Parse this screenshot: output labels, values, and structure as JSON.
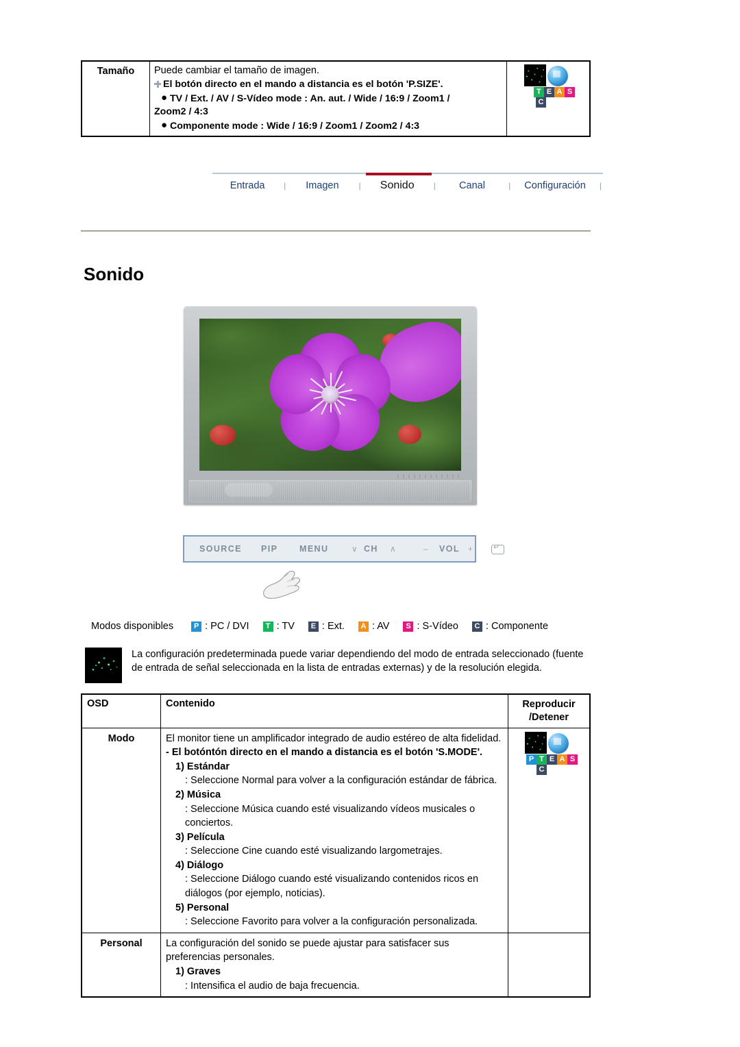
{
  "top_table": {
    "label": "Tamaño",
    "lines": [
      {
        "style": "plain",
        "text": "Puede cambiar el tamaño de imagen."
      },
      {
        "style": "bold-plus",
        "text": "El botón directo en el mando a distancia es el botón 'P.SIZE'."
      },
      {
        "style": "bold-bullet",
        "text": "TV / Ext. / AV / S-Vídeo mode : An. aut. / Wide / 16:9 / Zoom1 /"
      },
      {
        "style": "bold-cont",
        "text": "Zoom2 / 4:3"
      },
      {
        "style": "bold-bullet",
        "text": "Componente mode : Wide / 16:9 / Zoom1 / Zoom2 / 4:3"
      }
    ],
    "icon_badges": [
      "T",
      "E",
      "A",
      "S"
    ],
    "icon_badge_below": "C"
  },
  "nav": {
    "items": [
      {
        "label": "Entrada",
        "active": false
      },
      {
        "label": "Imagen",
        "active": false
      },
      {
        "label": "Sonido",
        "active": true
      },
      {
        "label": "Canal",
        "active": false
      },
      {
        "label": "Configuración",
        "active": false
      }
    ],
    "separator": "|",
    "active_color": "#a51025",
    "link_color": "#1c3f73"
  },
  "page_title": "Sonido",
  "monitor": {
    "buttons": [
      {
        "name": "source",
        "label": "SOURCE"
      },
      {
        "name": "pip",
        "label": "PIP"
      },
      {
        "name": "menu",
        "label": "MENU"
      },
      {
        "name": "ch-down",
        "label": "∨"
      },
      {
        "name": "ch",
        "label": "CH"
      },
      {
        "name": "ch-up",
        "label": "∧"
      },
      {
        "name": "vol-minus",
        "label": "–"
      },
      {
        "name": "vol",
        "label": "VOL"
      },
      {
        "name": "vol-plus",
        "label": "+"
      }
    ],
    "enter_icon": "enter-icon"
  },
  "modos": {
    "label": "Modos disponibles",
    "items": [
      {
        "letter": "P",
        "color": "#1f93d6",
        "text": ": PC / DVI"
      },
      {
        "letter": "T",
        "color": "#17b45c",
        "text": ": TV"
      },
      {
        "letter": "E",
        "color": "#3c4a63",
        "text": ": Ext."
      },
      {
        "letter": "A",
        "color": "#f39019",
        "text": ": AV"
      },
      {
        "letter": "S",
        "color": "#e0197e",
        "text": ": S-Vídeo"
      },
      {
        "letter": "C",
        "color": "#3c4a63",
        "text": ": Componente"
      }
    ]
  },
  "note": {
    "icon": "equalizer-icon",
    "text": "La configuración predeterminada puede variar dependiendo del modo de entrada seleccionado (fuente de entrada de señal seleccionada en la lista de entradas externas) y de la resolución elegida."
  },
  "main_table": {
    "headers": {
      "osd": "OSD",
      "content": "Contenido",
      "play_line1": "Reproducir",
      "play_line2": "/Detener"
    },
    "rows": [
      {
        "osd": "Modo",
        "lines": [
          {
            "style": "plain",
            "text": "El monitor tiene un amplificador integrado de audio estéreo de alta fidelidad."
          },
          {
            "style": "bold",
            "text": "- El botóntón directo en el mando a distancia es el botón 'S.MODE'."
          },
          {
            "style": "num",
            "text": "1) Estándar"
          },
          {
            "style": "desc",
            "text": ": Seleccione Normal para volver a la configuración estándar de fábrica."
          },
          {
            "style": "num",
            "text": "2) Música"
          },
          {
            "style": "desc",
            "text": ": Seleccione Música cuando esté visualizando vídeos musicales o conciertos."
          },
          {
            "style": "num",
            "text": "3) Película"
          },
          {
            "style": "desc",
            "text": ": Seleccione Cine cuando esté visualizando largometrajes."
          },
          {
            "style": "num",
            "text": "4) Diálogo"
          },
          {
            "style": "desc",
            "text": ": Seleccione Diálogo cuando esté visualizando contenidos ricos en diálogos (por ejemplo, noticias)."
          },
          {
            "style": "num",
            "text": "5) Personal"
          },
          {
            "style": "desc",
            "text": ": Seleccione Favorito para volver a la configuración personalizada."
          }
        ],
        "has_icon": true,
        "icon_badges": [
          "P",
          "T",
          "E",
          "A",
          "S"
        ],
        "icon_badge_below": "C"
      },
      {
        "osd": "Personal",
        "lines": [
          {
            "style": "plain",
            "text": "La configuración del sonido se puede ajustar para satisfacer sus preferencias personales."
          },
          {
            "style": "num",
            "text": "1) Graves"
          },
          {
            "style": "desc",
            "text": ": Intensifica el audio de baja frecuencia."
          }
        ],
        "has_icon": false,
        "icon_badges": [],
        "icon_badge_below": ""
      }
    ]
  }
}
